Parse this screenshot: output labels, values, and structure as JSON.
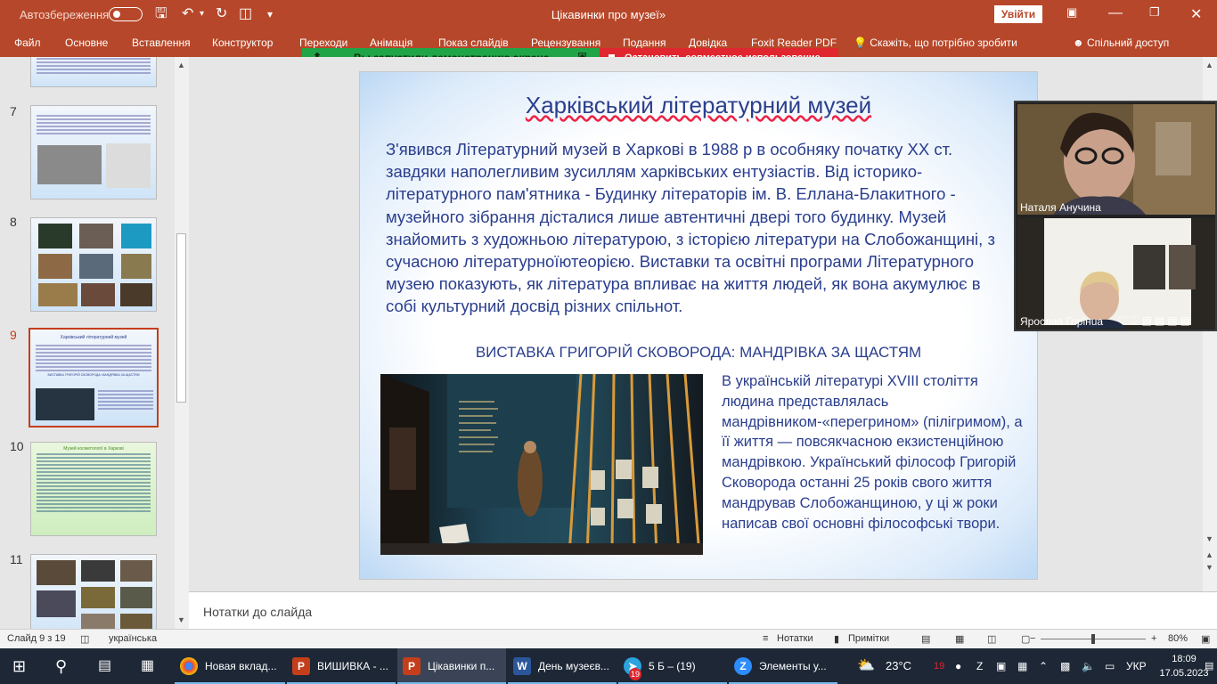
{
  "titlebar": {
    "autosave_label": "Автозбереження",
    "autosave_state": "off",
    "doc_title": "Цікавинки про музеї»",
    "signin_label": "Увійти",
    "icons": [
      "save-icon",
      "undo-icon",
      "redo-icon",
      "present-icon",
      "customize-icon"
    ]
  },
  "ribbon": {
    "tabs": [
      "Файл",
      "Основне",
      "Вставлення",
      "Конструктор",
      "Переходи",
      "Анімація",
      "Показ слайдів",
      "Рецензування",
      "Подання",
      "Довідка",
      "Foxit Reader PDF"
    ],
    "tell_me": "Скажіть, що потрібно зробити",
    "share": "Спільний доступ"
  },
  "share_bar": {
    "green_text": "Вы запустили демонстрацию экрана",
    "red_text": "Остановить совместное использование",
    "green_color": "#1fa547",
    "red_color": "#e0262e"
  },
  "thumbnails": {
    "numbers": [
      "7",
      "8",
      "9",
      "10",
      "11"
    ],
    "active": "9",
    "slide9_title": "Харківський літературний музей",
    "slide9_sub": "ВИСТАВКА ГРИГОРІЙ СКОВОРОДА: МАНДРІВКА ЗА ЩАСТЯМ",
    "slide10_title": "Музей косметології в Харкові"
  },
  "slide": {
    "title": "Харківський літературний музей",
    "paragraph": "З'явився Літературний музей в Харкові в 1988 р в особняку початку ХХ ст. завдяки наполегливим зусиллям харківських ентузіастів. Від історико-літературного пам'ятника - Будинку літераторів ім. В. Еллана-Блакитного - музейного зібрання дісталися лише автентичні двері того будинку. Музей знайомить з художньою літературою, з історією літератури на Слобожанщині, з сучасною літературноїютеорією. Виставки та освітні програми Літературного музею показують, як література впливає на життя людей, як вона акумулює в собі культурний досвід різних спільнот.",
    "subtitle": "ВИСТАВКА ГРИГОРІЙ СКОВОРОДА: МАНДРІВКА ЗА ЩАСТЯМ",
    "side_text": "В українській літературі XVIII століття людина представлялась мандрівником-«перегрином» (пілігримом), а її життя — повсякчасною екзистенційною мандрівкою. Український філософ Григорій Сковорода останні 25 років свого життя мандрував Слобожанщиною, у ці ж роки написав свої основні філософські твори."
  },
  "video": {
    "participant1": "Наталя Анучина",
    "participant2": "Ярослав Горінuа"
  },
  "notes": {
    "placeholder": "Нотатки до слайда"
  },
  "status": {
    "slide_info": "Слайд 9 з 19",
    "language": "українська",
    "notes_btn": "Нотатки",
    "comments_btn": "Примітки",
    "zoom": "80%",
    "zoom_fraction": 0.5
  },
  "taskbar": {
    "items": [
      {
        "label": "Новая вклад...",
        "icon": "chrome-icon"
      },
      {
        "label": "ВИШИВКА - ...",
        "icon": "powerpoint-icon"
      },
      {
        "label": "Цікавинки п...",
        "icon": "powerpoint-icon"
      },
      {
        "label": "День музеєв...",
        "icon": "word-icon"
      },
      {
        "label": "5 Б – (19)",
        "icon": "telegram-icon"
      },
      {
        "label": "Элементы у...",
        "icon": "zoom-icon"
      }
    ],
    "telegram_badge": "19",
    "tray_badge": "19",
    "weather": "23°C",
    "lang": "УКР",
    "time": "18:09",
    "date": "17.05.2023"
  }
}
